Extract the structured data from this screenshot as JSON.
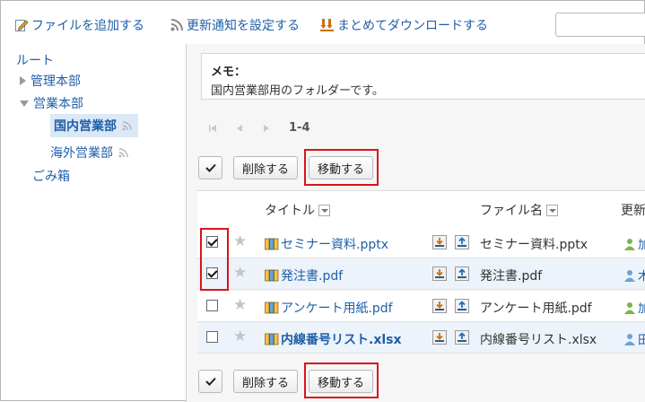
{
  "toolbar": {
    "add_file": "ファイルを追加する",
    "notify": "更新通知を設定する",
    "download": "まとめてダウンロードする"
  },
  "tree": {
    "root": "ルート",
    "items": [
      "管理本部",
      "営業本部",
      "国内営業部",
      "海外営業部"
    ],
    "trash": "ごみ箱"
  },
  "memo": {
    "title": "メモ：",
    "text": "国内営業部用のフォルダーです。"
  },
  "pager": {
    "range": "1-4"
  },
  "actions": {
    "delete": "削除する",
    "move": "移動する"
  },
  "table": {
    "headers": {
      "title": "タイトル",
      "filename": "ファイル名",
      "updated": "更新"
    },
    "rows": [
      {
        "title": "セミナー資料.pptx",
        "filename": "セミナー資料.pptx",
        "user": "加",
        "checked": true,
        "bold": false
      },
      {
        "title": "発注書.pdf",
        "filename": "発注書.pdf",
        "user": "木",
        "checked": true,
        "bold": false
      },
      {
        "title": "アンケート用紙.pdf",
        "filename": "アンケート用紙.pdf",
        "user": "加",
        "checked": false,
        "bold": false
      },
      {
        "title": "内線番号リスト.xlsx",
        "filename": "内線番号リスト.xlsx",
        "user": "田",
        "checked": false,
        "bold": true
      }
    ]
  },
  "colors": {
    "link": "#1f5fa8",
    "highlight": "#d9141b",
    "selected_bg": "#dbe8f5"
  }
}
